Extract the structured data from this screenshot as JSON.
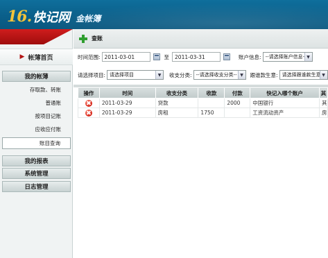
{
  "header": {
    "logo_mark": "16.",
    "logo_text": "快记网",
    "logo_sub": "金帐簿"
  },
  "sidebar": {
    "home": "帐薄首页",
    "sections": [
      {
        "label": "我的帐薄"
      },
      {
        "label": "我的报表"
      },
      {
        "label": "系统管理"
      },
      {
        "label": "日志管理"
      }
    ],
    "items": [
      {
        "label": "存取款、转账"
      },
      {
        "label": "普通账"
      },
      {
        "label": "按项目记账"
      },
      {
        "label": "应收应付账"
      },
      {
        "label": "账目查询"
      }
    ]
  },
  "toolbar": {
    "label": "查账"
  },
  "filters": {
    "time_label": "时间范围:",
    "date_from": "2011-03-01",
    "to_label": "至",
    "date_to": "2011-03-31",
    "account_label": "账户信息:",
    "account_value": "--请选择账户信息--",
    "project_label": "请选择项目:",
    "project_value": "请选择项目",
    "category_label": "收支分类:",
    "category_value": "--请选择收支分类--",
    "trail_label": "跟谁款生意:",
    "trail_value": "请选择跟谁款生意"
  },
  "table": {
    "headers": [
      "操作",
      "时间",
      "收支分类",
      "收款",
      "付款",
      "快记入哪个账户",
      "其"
    ],
    "rows": [
      {
        "time": "2011-03-29",
        "category": "贷款",
        "income": "",
        "expense": "2000",
        "account": "中国银行",
        "extra": "其"
      },
      {
        "time": "2011-03-29",
        "category": "房租",
        "income": "1750",
        "expense": "",
        "account": "工资流动资产",
        "extra": "房"
      }
    ]
  },
  "colors": {
    "header_blue": "#0a5f8a",
    "accent_red": "#c21818",
    "plus_green": "#2f9e2f"
  }
}
